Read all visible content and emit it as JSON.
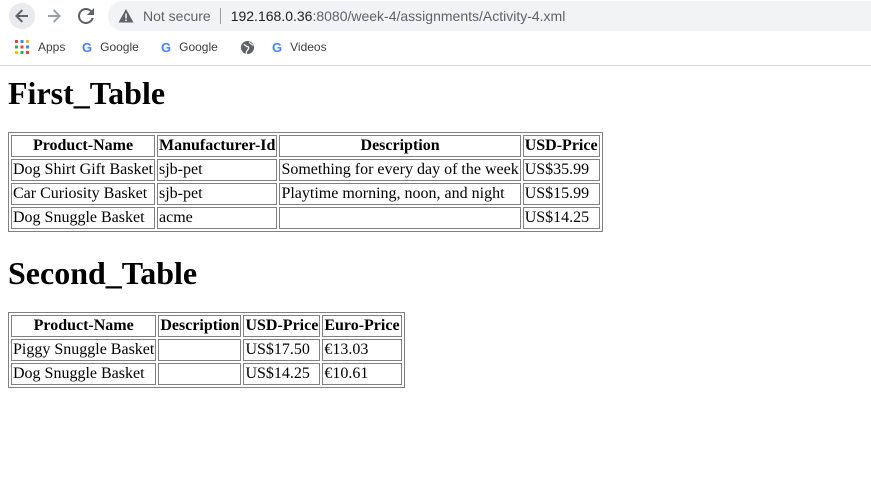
{
  "browser": {
    "security_label": "Not secure",
    "url_host": "192.168.0.36",
    "url_path": ":8080/week-4/assignments/Activity-4.xml"
  },
  "bookmarks": [
    {
      "label": "Apps",
      "icon": "apps-grid-icon"
    },
    {
      "label": "Google",
      "icon": "google-icon"
    },
    {
      "label": "Google",
      "icon": "google-icon"
    },
    {
      "label": "",
      "icon": "globe-icon"
    },
    {
      "label": "Videos",
      "icon": "google-icon"
    }
  ],
  "page": {
    "first_heading": "First_Table",
    "second_heading": "Second_Table"
  },
  "first_table": {
    "headers": [
      "Product-Name",
      "Manufacturer-Id",
      "Description",
      "USD-Price"
    ],
    "rows": [
      [
        "Dog Shirt Gift Basket",
        "sjb-pet",
        "Something for every day of the week",
        "US$35.99"
      ],
      [
        "Car Curiosity Basket",
        "sjb-pet",
        "Playtime morning, noon, and night",
        "US$15.99"
      ],
      [
        "Dog Snuggle Basket",
        "acme",
        "",
        "US$14.25"
      ]
    ]
  },
  "second_table": {
    "headers": [
      "Product-Name",
      "Description",
      "USD-Price",
      "Euro-Price"
    ],
    "rows": [
      [
        "Piggy Snuggle Basket",
        "",
        "US$17.50",
        "€13.03"
      ],
      [
        "Dog Snuggle Basket",
        "",
        "US$14.25",
        "€10.61"
      ]
    ]
  },
  "colors": {
    "icon_gray": "#5f6368",
    "omnibox_bg": "#f1f3f4",
    "google_blue": "#4285f4"
  }
}
